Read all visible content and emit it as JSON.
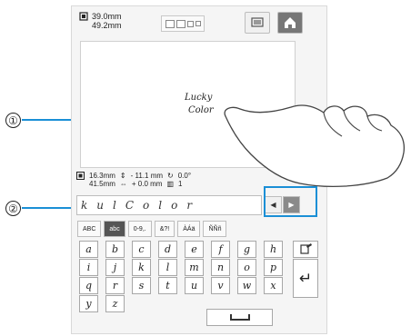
{
  "header": {
    "width_value": "39.0mm",
    "height_value": "49.2mm"
  },
  "preview": {
    "line1": "Lucky",
    "line2": "Color"
  },
  "info": {
    "size_w": "16.3mm",
    "size_h": "41.5mm",
    "vert_offset": "- 11.1 mm",
    "horiz_offset": "+ 0.0 mm",
    "angle": "0.0°",
    "color_count": "1"
  },
  "char_strip": [
    "k",
    "u",
    "l",
    "C",
    "o",
    "l",
    "o",
    "r"
  ],
  "tabs": [
    {
      "label": "ABC",
      "active": false
    },
    {
      "label": "abc",
      "active": true
    },
    {
      "label": "0-9,.",
      "active": false
    },
    {
      "label": "&?!",
      "active": false
    },
    {
      "label": "ÀÁä",
      "active": false
    },
    {
      "label": "ÑÑñ",
      "active": false
    }
  ],
  "keys": {
    "row1": [
      "a",
      "b",
      "c",
      "d",
      "e",
      "f",
      "g",
      "h"
    ],
    "row2": [
      "i",
      "j",
      "k",
      "l",
      "m",
      "n",
      "o",
      "p"
    ],
    "row3": [
      "q",
      "r",
      "s",
      "t",
      "u",
      "v",
      "w",
      "x"
    ],
    "row4": [
      "y",
      "z"
    ]
  },
  "callouts": {
    "c1": "①",
    "c2": "②"
  },
  "colors": {
    "accent": "#1a8fd6",
    "active_tab": "#555555"
  }
}
